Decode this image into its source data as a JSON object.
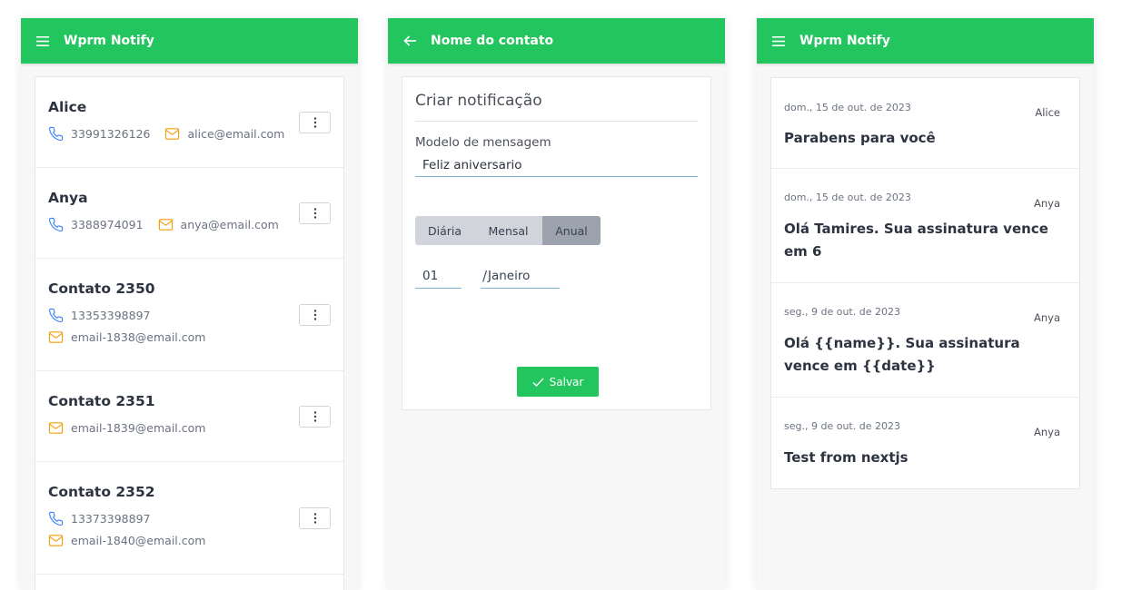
{
  "screens": [
    {
      "app_title": "Wprm Notify",
      "contacts": [
        {
          "name": "Alice",
          "phone": "33991326126",
          "email": "alice@email.com"
        },
        {
          "name": "Anya",
          "phone": "3388974091",
          "email": "anya@email.com"
        },
        {
          "name": "Contato 2350",
          "phone": "13353398897",
          "email": "email-1838@email.com"
        },
        {
          "name": "Contato 2351",
          "email": "email-1839@email.com"
        },
        {
          "name": "Contato 2352",
          "phone": "13373398897",
          "email": "email-1840@email.com"
        }
      ]
    },
    {
      "app_title": "Nome do contato",
      "form": {
        "title": "Criar notificação",
        "template_label": "Modelo de mensagem",
        "template_value": "Feliz aniversario",
        "frequency_options": [
          "Diária",
          "Mensal",
          "Anual"
        ],
        "frequency_selected": "Anual",
        "day": "01",
        "separator": "/",
        "month": "Janeiro",
        "save_label": "Salvar"
      }
    },
    {
      "app_title": "Wprm Notify",
      "notifications": [
        {
          "date": "dom., 15 de out. de 2023",
          "contact": "Alice",
          "message": "Parabens para você"
        },
        {
          "date": "dom., 15 de out. de 2023",
          "contact": "Anya",
          "message": "Olá Tamires. Sua assinatura vence em 6"
        },
        {
          "date": "seg., 9 de out. de 2023",
          "contact": "Anya",
          "message": "Olá {{name}}. Sua assinatura vence em {{date}}"
        },
        {
          "date": "seg., 9 de out. de 2023",
          "contact": "Anya",
          "message": "Test from nextjs"
        }
      ]
    }
  ],
  "colors": {
    "primary": "#22c55e",
    "phone_icon": "#3b82f6",
    "email_icon": "#f59e0b"
  },
  "icons": {
    "menu": "menu-icon",
    "back": "arrow-left-icon",
    "phone": "phone-icon",
    "email": "mail-icon",
    "more": "more-vertical-icon",
    "check": "check-icon"
  }
}
